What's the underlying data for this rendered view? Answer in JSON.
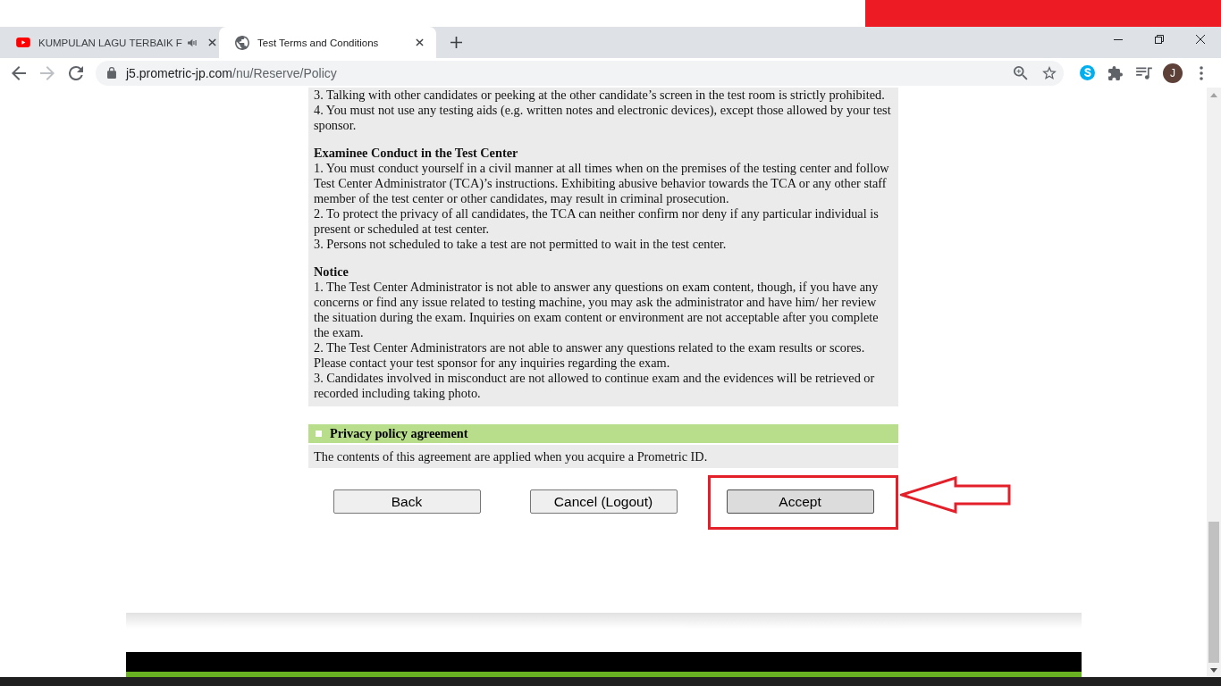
{
  "browser": {
    "tabs": [
      {
        "kind": "video",
        "title": "KUMPULAN LAGU TERBAIK F",
        "audio": true,
        "selected": false
      },
      {
        "kind": "page",
        "title": "Test Terms and Conditions",
        "audio": false,
        "selected": true
      }
    ],
    "address": {
      "host": "j5.prometric-jp.com",
      "path": "/nu/Reserve/Policy"
    },
    "profile": {
      "initial": "J"
    }
  },
  "page": {
    "sections": [
      {
        "items": [
          "3. Talking with other candidates or peeking at the other candidate’s screen in the test room is strictly prohibited.",
          "4. You must not use any testing aids (e.g. written notes and electronic devices), except those allowed by your test sponsor."
        ]
      },
      {
        "heading": "Examinee Conduct in the Test Center",
        "items": [
          "1. You must conduct yourself in a civil manner at all times when on the premises of the testing center and follow Test Center Administrator (TCA)’s instructions. Exhibiting abusive behavior towards the TCA or any other staff member of the test center or other candidates, may result in criminal prosecution.",
          "2. To protect the privacy of all candidates, the TCA can neither confirm nor deny if any particular individual is present or scheduled at test center.",
          "3. Persons not scheduled to take a test are not permitted to wait in the test center."
        ]
      },
      {
        "heading": "Notice",
        "items": [
          "1. The Test Center Administrator is not able to answer any questions on exam content, though, if you have any concerns or find any issue related to testing machine, you may ask the administrator and have him/ her review the situation during the exam. Inquiries on exam content or environment are not acceptable after you complete the exam.",
          "2. The Test Center Administrators are not able to answer any questions related to the exam results or scores. Please contact your test sponsor for any inquiries regarding the exam.",
          "3. Candidates involved in misconduct are not allowed to continue exam and the evidences will be retrieved or recorded including taking photo."
        ]
      }
    ],
    "privacy": {
      "heading": "Privacy policy agreement",
      "text": "The contents of this agreement are applied when you acquire a Prometric ID."
    },
    "buttons": [
      {
        "label": "Back",
        "hovered": false,
        "annotated": false
      },
      {
        "label": "Cancel (Logout)",
        "hovered": false,
        "annotated": false
      },
      {
        "label": "Accept",
        "hovered": true,
        "annotated": true
      }
    ]
  }
}
